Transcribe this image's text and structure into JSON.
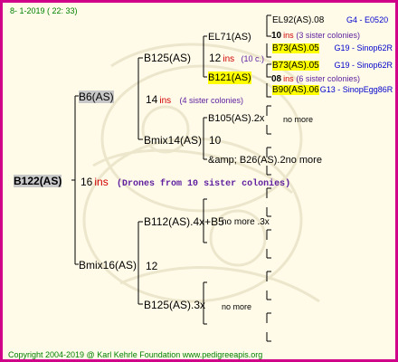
{
  "header": {
    "date": "8- 1-2019 ( 22: 33)"
  },
  "footer": {
    "copyright": "Copyright 2004-2019 @ Karl Kehrle Foundation   www.pedigreeapis.org"
  },
  "gen0": {
    "name": "B122(AS)",
    "ins_num": "16",
    "ins_word": "ins",
    "note": "(Drones from 10 sister colonies)"
  },
  "gen1": [
    {
      "name": "B6(AS)",
      "ins_num": "14",
      "ins_word": "ins",
      "note": "(4 sister colonies)"
    },
    {
      "name": "Bmix16(AS)",
      "num": "12"
    }
  ],
  "gen2": [
    {
      "name": "B125(AS)",
      "ins_num": "12",
      "ins_word": "ins",
      "note": "(10 c.)"
    },
    {
      "name": "Bmix14(AS)",
      "num": "10"
    },
    {
      "name": "B112(AS).4x+B5",
      "extra": "no more .3x"
    },
    {
      "name": "B125(AS).3x",
      "extra": "no more"
    }
  ],
  "gen3": [
    {
      "name": "EL71(AS)",
      "ins_num": "10",
      "ins_word": "ins",
      "note": "(3 sister colonies)"
    },
    {
      "name": "B121(AS)",
      "ins_num": "08",
      "ins_word": "ins",
      "note": "(6 sister colonies)"
    },
    {
      "name": "B105(AS).2x",
      "extra": "no more"
    },
    {
      "name": "&amp; B26(AS).2no more"
    }
  ],
  "gen4": [
    {
      "name": "EL92(AS).08",
      "code": "G4 - E0520"
    },
    {
      "name": "B73(AS).05",
      "code": "G19 - Sinop62R"
    },
    {
      "name": "B73(AS).05",
      "code": "G19 - Sinop62R"
    },
    {
      "name": "B90(AS).06",
      "code": "G13 - SinopEgg86R"
    }
  ]
}
